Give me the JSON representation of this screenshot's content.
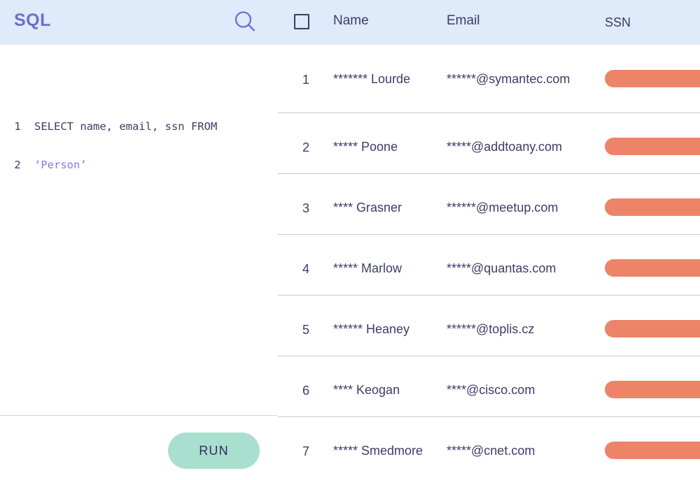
{
  "header": {
    "brand": "SQL",
    "search_icon": "search-icon",
    "select_all_checkbox": "",
    "columns": [
      {
        "key": "name",
        "label": "Name"
      },
      {
        "key": "email",
        "label": "Email"
      },
      {
        "key": "ssn",
        "label": "SSN"
      }
    ],
    "background_color": "#dfeafb",
    "brand_color": "#6c6fd0"
  },
  "editor": {
    "lines": [
      {
        "number": "1",
        "text": "SELECT name, email, ssn FROM",
        "type": "plain"
      },
      {
        "number": "2",
        "text": "‘Person’",
        "type": "string"
      }
    ],
    "run_label": "RUN",
    "run_button_color": "#a9dfce"
  },
  "results": {
    "ssn_bar_color": "#ed8468",
    "rows": [
      {
        "index": "1",
        "name": "******* Lourde",
        "email": "******@symantec.com",
        "ssn": "redacted-bar"
      },
      {
        "index": "2",
        "name": "***** Poone",
        "email": "*****@addtoany.com",
        "ssn": "redacted-bar"
      },
      {
        "index": "3",
        "name": "**** Grasner",
        "email": "******@meetup.com",
        "ssn": "redacted-bar"
      },
      {
        "index": "4",
        "name": "***** Marlow",
        "email": "*****@quantas.com",
        "ssn": "redacted-bar"
      },
      {
        "index": "5",
        "name": "****** Heaney",
        "email": "******@toplis.cz",
        "ssn": "redacted-bar"
      },
      {
        "index": "6",
        "name": "**** Keogan",
        "email": "****@cisco.com",
        "ssn": "redacted-bar"
      },
      {
        "index": "7",
        "name": "***** Smedmore",
        "email": "*****@cnet.com",
        "ssn": "redacted-bar"
      }
    ]
  }
}
